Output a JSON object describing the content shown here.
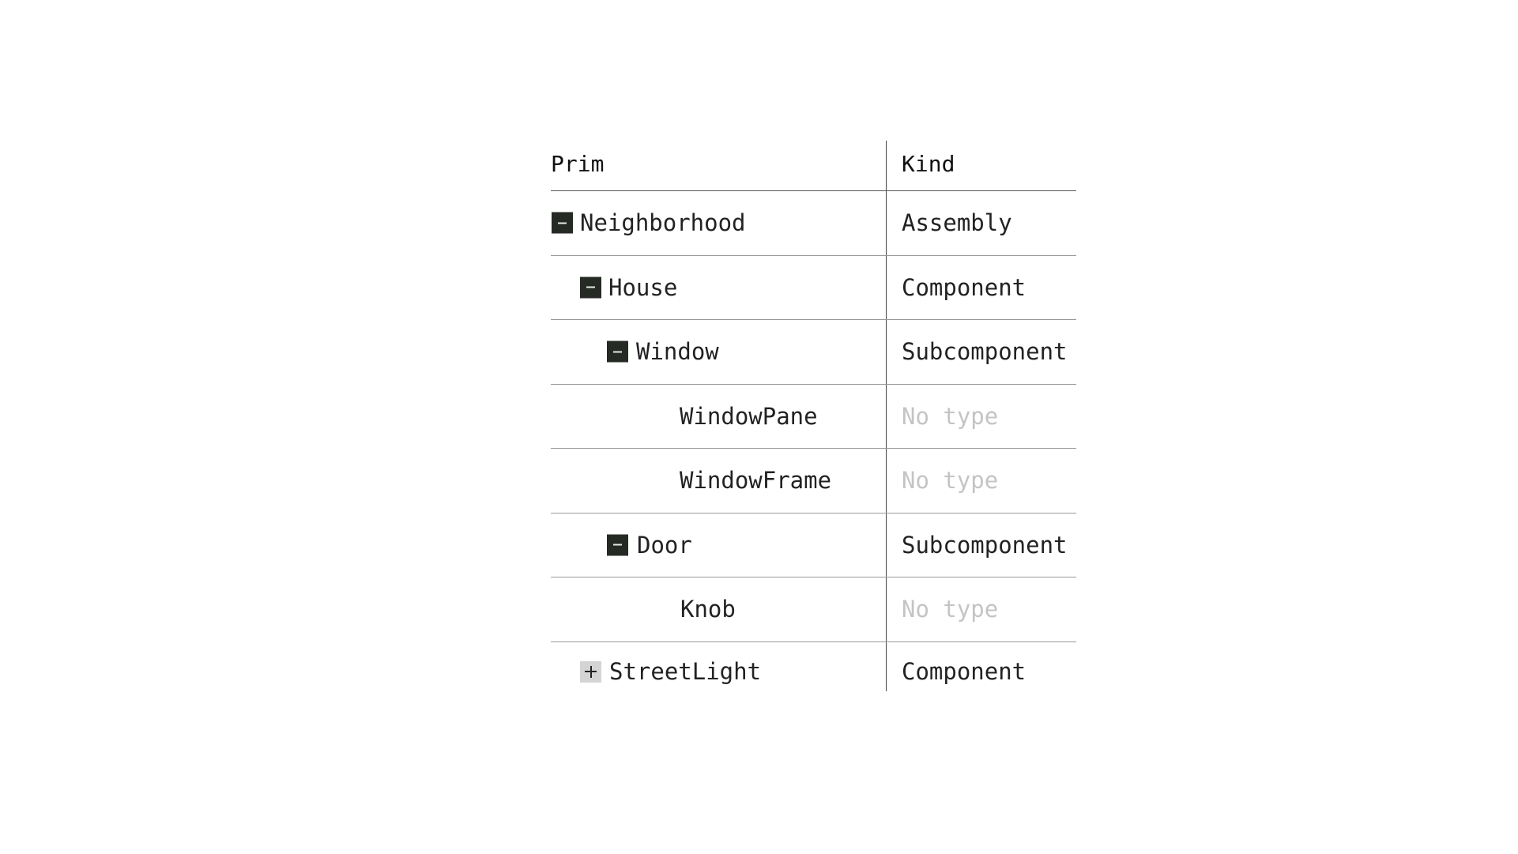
{
  "columns": {
    "prim": "Prim",
    "kind": "Kind"
  },
  "rows": [
    {
      "name": "Neighborhood",
      "kind": "Assembly",
      "toggle": "expanded"
    },
    {
      "name": "House",
      "kind": "Component",
      "toggle": "expanded"
    },
    {
      "name": "Window",
      "kind": "Subcomponent",
      "toggle": "expanded"
    },
    {
      "name": "WindowPane",
      "kind": "No type",
      "toggle": "none"
    },
    {
      "name": "WindowFrame",
      "kind": "No type",
      "toggle": "none"
    },
    {
      "name": "Door",
      "kind": "Subcomponent",
      "toggle": "expanded"
    },
    {
      "name": "Knob",
      "kind": "No type",
      "toggle": "none"
    },
    {
      "name": "StreetLight",
      "kind": "Component",
      "toggle": "collapsed"
    }
  ],
  "colors": {
    "toggle_expanded_bg": "#252a24",
    "toggle_collapsed_bg": "#d4d4d4",
    "no_type_text": "#c4c4c4",
    "text": "#222222"
  }
}
